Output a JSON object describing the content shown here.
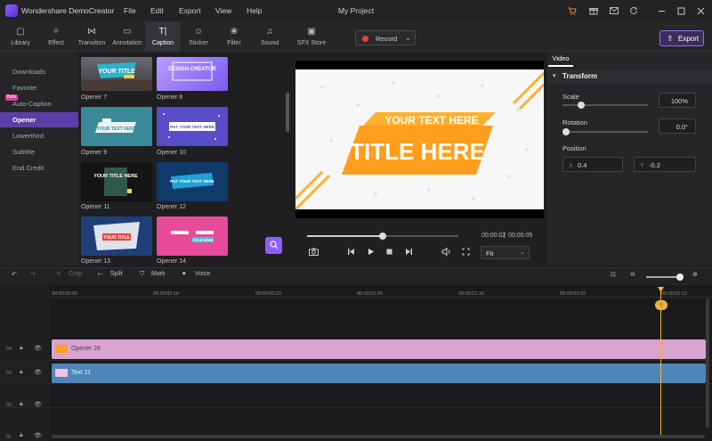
{
  "app": {
    "name": "Wondershare DemoCreator",
    "project_title": "My Project"
  },
  "menu": [
    "File",
    "Edit",
    "Export",
    "View",
    "Help"
  ],
  "toolbar": {
    "tabs": [
      {
        "label": "Library",
        "icon": "library-icon"
      },
      {
        "label": "Effect",
        "icon": "effect-icon"
      },
      {
        "label": "Transition",
        "icon": "transition-icon"
      },
      {
        "label": "Annotation",
        "icon": "annotation-icon"
      },
      {
        "label": "Caption",
        "icon": "caption-icon",
        "active": true
      },
      {
        "label": "Sticker",
        "icon": "sticker-icon"
      },
      {
        "label": "Filter",
        "icon": "filter-icon"
      },
      {
        "label": "Sound",
        "icon": "sound-icon"
      },
      {
        "label": "SFX Store",
        "icon": "sfx-store-icon"
      }
    ],
    "record_label": "Record",
    "export_label": "Export"
  },
  "categories": {
    "items": [
      "Downloads",
      "Favorite",
      "Auto-Caption",
      "Opener",
      "Lowerthird",
      "Subtitle",
      "End Credit"
    ],
    "active": "Opener",
    "beta_badge": "Beta"
  },
  "thumbnails": [
    {
      "label": "Opener 7",
      "text": "YOUR TITLE"
    },
    {
      "label": "Opener 8",
      "text": "DESIGN CREATOR"
    },
    {
      "label": "Opener 9",
      "text": "YOUR TEXT HERE"
    },
    {
      "label": "Opener 10",
      "text": "PUT YOUR TEXT HERE"
    },
    {
      "label": "Opener 11",
      "text": "YOUR TITLE HERE"
    },
    {
      "label": "Opener 12",
      "text": "PUT YOUR TEXT HERE"
    },
    {
      "label": "Opener 13",
      "text": "YOUR TITLE"
    },
    {
      "label": "Opener 14",
      "text": "TITLE HERE"
    }
  ],
  "preview": {
    "subtitle_text": "YOUR TEXT HERE",
    "title_text": "TITLE HERE",
    "current_time": "00:00:02",
    "total_time": "00:00:05",
    "fit_label": "Fit",
    "progress": 0.5
  },
  "properties": {
    "tab_label": "Video",
    "section_label": "Transform",
    "scale_label": "Scale",
    "scale_value": "100%",
    "rotation_label": "Rotation",
    "rotation_value": "0.0°",
    "position_label": "Position",
    "x_label": "X",
    "x_value": "0.4",
    "y_label": "Y",
    "y_value": "-0.2"
  },
  "timeline_toolbar": {
    "crop_label": "Crop",
    "split_label": "Split",
    "mark_label": "Mark",
    "voice_label": "Voice"
  },
  "ruler_ticks": [
    "00:00:00:00",
    "00:00:00:10",
    "00:00:00:20",
    "00:00:01:06",
    "00:00:01:16",
    "00:00:02:02",
    "00:00:02:12"
  ],
  "tracks": [
    {
      "num": "04",
      "clip": "Opener 26",
      "color": "#d9a3d0"
    },
    {
      "num": "03",
      "clip": "Text 11",
      "color": "#4f86b8"
    },
    {
      "num": "02",
      "clip": ""
    },
    {
      "num": "01",
      "clip": ""
    }
  ],
  "colors": {
    "accent": "#8e5cff",
    "playhead": "#f0b43c",
    "preview_orange": "#ff9d1c"
  }
}
